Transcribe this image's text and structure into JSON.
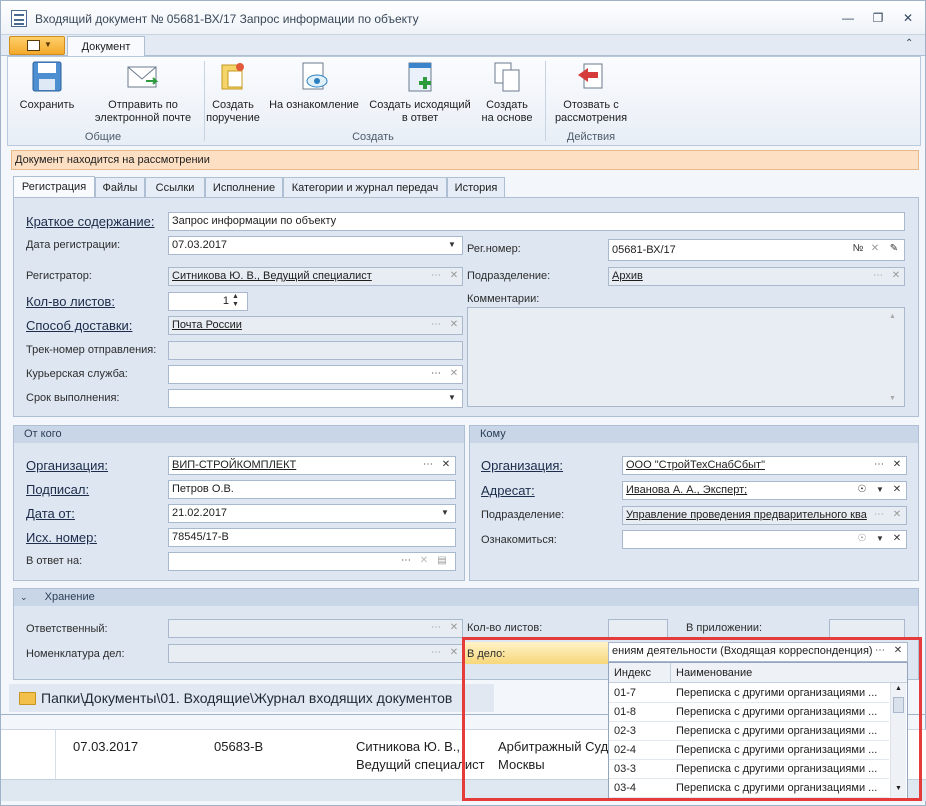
{
  "window": {
    "title": "Входящий документ № 05681-ВХ/17 Запрос информации по объекту"
  },
  "ribbon": {
    "tab": "Документ",
    "buttons": {
      "save": "Сохранить",
      "send_email": "Отправить по электронной почте",
      "create_task": "Создать поручение",
      "acquaint": "На ознакомление",
      "create_reply": "Создать исходящий в ответ",
      "create_based": "Создать на основе",
      "recall": "Отозвать с рассмотрения"
    },
    "groups": {
      "common": "Общие",
      "create": "Создать",
      "actions": "Действия"
    }
  },
  "status": "Документ находится на рассмотрении",
  "tabs": [
    "Регистрация",
    "Файлы",
    "Ссылки",
    "Исполнение",
    "Категории и журнал передач",
    "История"
  ],
  "reg": {
    "summary_label": "Краткое содержание:",
    "summary": "Запрос информации по объекту",
    "date_label": "Дата регистрации:",
    "date": "07.03.2017",
    "regnum_label": "Рег.номер:",
    "regnum": "05681-ВХ/17",
    "num_sign": "№",
    "registrar_label": "Регистратор:",
    "registrar": "Ситникова Ю. В., Ведущий специалист",
    "department_label": "Подразделение:",
    "department": "Архив",
    "sheets_label": "Кол-во листов:",
    "sheets": "1",
    "comments_label": "Комментарии:",
    "delivery_label": "Способ доставки:",
    "delivery": "Почта России",
    "track_label": "Трек-номер отправления:",
    "courier_label": "Курьерская служба:",
    "deadline_label": "Срок выполнения:"
  },
  "from": {
    "header": "От кого",
    "org_label": "Организация:",
    "org": "ВИП-СТРОЙКОМПЛЕКТ",
    "signed_label": "Подписал:",
    "signed": "Петров О.В.",
    "date_label": "Дата от:",
    "date": "21.02.2017",
    "outnum_label": "Исх. номер:",
    "outnum": "78545/17-В",
    "reply_label": "В ответ на:"
  },
  "to": {
    "header": "Кому",
    "org_label": "Организация:",
    "org": "ООО \"СтройТехСнабСбыт\"",
    "addressee_label": "Адресат:",
    "addressee": "Иванова А. А., Эксперт;",
    "dept_label": "Подразделение:",
    "dept": "Управление проведения предварительного ква",
    "acq_label": "Ознакомиться:"
  },
  "storage": {
    "header": "Хранение",
    "responsible_label": "Ответственный:",
    "sheets_label": "Кол-во листов:",
    "appendix_label": "В приложении:",
    "nomenclature_label": "Номенклатура дел:",
    "case_label": "В дело:",
    "case_value": "ениям деятельности (Входящая корреспонденция)"
  },
  "dropdown": {
    "col_index": "Индекс",
    "col_name": "Наименование",
    "rows": [
      {
        "idx": "01-7",
        "name": "Переписка с другими организациями ..."
      },
      {
        "idx": "01-8",
        "name": "Переписка с другими организациями ..."
      },
      {
        "idx": "02-3",
        "name": "Переписка с другими организациями ..."
      },
      {
        "idx": "02-4",
        "name": "Переписка с другими организациями ..."
      },
      {
        "idx": "03-3",
        "name": "Переписка с другими организациями ..."
      },
      {
        "idx": "03-4",
        "name": "Переписка с другими организациями ..."
      }
    ]
  },
  "path": "Папки\\Документы\\01. Входящие\\Журнал входящих документов",
  "grid": {
    "date": "07.03.2017",
    "num": "05683-В",
    "person1": "Ситникова Ю. В.,",
    "person2": "Ведущий специалист",
    "org1": "Арбитражный Суд",
    "org2": "Москвы"
  }
}
